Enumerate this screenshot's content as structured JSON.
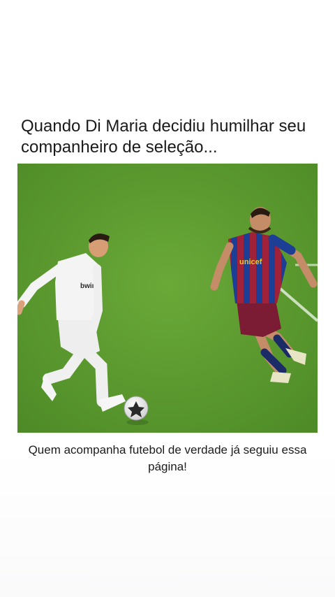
{
  "post": {
    "headline": "Quando Di Maria decidiu humilhar seu companheiro de seleção...",
    "caption": "Quem acompanha futebol de verdade já seguiu essa página!"
  },
  "media": {
    "jersey_left_text": "bwin",
    "jersey_right_text": "unicef",
    "pitch_color": "#5f9d31",
    "white_kit_color": "#f2f2f2",
    "barca_blue": "#1c3f95",
    "barca_red": "#a0213a"
  }
}
